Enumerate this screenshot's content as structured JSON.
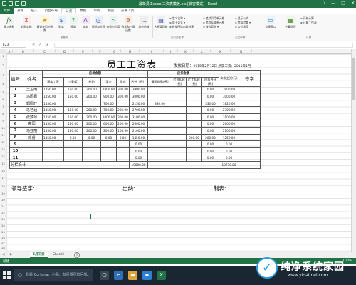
{
  "window": {
    "title": "最新员工excel工资表模板.xls [兼容模式] - Excel",
    "controls": [
      "?",
      "—",
      "□",
      "✕"
    ]
  },
  "ribbon": {
    "tabs": [
      "文件",
      "开始",
      "插入",
      "页面布局",
      "公式",
      "数据",
      "审阅",
      "视图",
      "开发工具"
    ],
    "buttons": [
      {
        "label": "插入函数",
        "icon": "fx"
      },
      {
        "label": "自动求和",
        "icon": "Σ"
      },
      {
        "label": "最近使用的函数",
        "icon": "★"
      },
      {
        "label": "财务",
        "icon": "$"
      },
      {
        "label": "逻辑",
        "icon": "?"
      },
      {
        "label": "文本",
        "icon": "A"
      },
      {
        "label": "日期和时间",
        "icon": "◷"
      },
      {
        "label": "查找与引用",
        "icon": "⌕"
      },
      {
        "label": "数学和三角函数",
        "icon": "θ"
      },
      {
        "label": "其他函数",
        "icon": "…"
      },
      {
        "label": "名称管理器",
        "icon": "▤"
      }
    ],
    "defined_names": [
      "定义名称 ▾",
      "用于公式 ▾",
      "根据所选内容创建"
    ],
    "auditing": [
      "追踪引用单元格",
      "追踪从属单元格",
      "移去箭头 ▾",
      "显示公式",
      "错误检查 ▾",
      "公式求值"
    ],
    "watch_label": "监视窗口",
    "calc_options_label": "计算选项",
    "calc_small": [
      "开始计算",
      "计算工作表"
    ],
    "groups": [
      "函数库",
      "定义的名称",
      "公式审核",
      "计算"
    ]
  },
  "formula_bar": {
    "name_box": "E23",
    "icons": [
      "✕",
      "✓",
      "fx"
    ],
    "value": ""
  },
  "columns": [
    "A",
    "B",
    "C",
    "D",
    "E",
    "F",
    "G",
    "H",
    "I",
    "J",
    "K",
    "L",
    "M",
    "N"
  ],
  "row_numbers": [
    "1",
    "2",
    "3",
    "4",
    "5",
    "6",
    "7",
    "8",
    "9",
    "10",
    "11",
    "12",
    "13",
    "14",
    "15",
    "16",
    "17",
    "18",
    "19",
    "20",
    "21",
    "22",
    "23",
    "24",
    "25",
    "26",
    "27",
    "28",
    "29",
    "30"
  ],
  "sheet": {
    "title": "员工工资表",
    "date_label": "发放日期：",
    "date_value": "2015年2月12日",
    "period": "所属工资：2015年1月",
    "headers": {
      "index": "编号",
      "name": "姓名",
      "earnings_group": "应发金额",
      "base": "基本工资",
      "allowance": "全勤奖",
      "subsidy": "补助",
      "bonus": "奖金",
      "extra": "提成",
      "subtotal": "合计（元）",
      "deduction_group": "应扣金额",
      "leave": "请假扣款(元)",
      "late": "迟到扣款(元)",
      "absence": "旷工扣款(元)",
      "deduct_total": "应扣合计(元)",
      "net": "实发工资(元)",
      "sign": "签字"
    },
    "rows": [
      {
        "no": "1",
        "name": "王卫雨",
        "base": "1450.00",
        "allow": "150.00",
        "sub": "200.00",
        "bonus": "1800.00",
        "extra": "300.00",
        "total": "3900.00",
        "leave": "",
        "late": "",
        "abs": "",
        "dtotal": "0.00",
        "net": "3900.00"
      },
      {
        "no": "2",
        "name": "马国嘉",
        "base": "1450.00",
        "allow": "150.00",
        "sub": "200.00",
        "bonus": "900.00",
        "extra": "300.00",
        "total": "3000.00",
        "leave": "",
        "late": "",
        "abs": "",
        "dtotal": "0.00",
        "net": "3000.00"
      },
      {
        "no": "3",
        "name": "郭国旺",
        "base": "1450.00",
        "allow": "",
        "sub": "",
        "bonus": "700.00",
        "extra": "",
        "total": "2150.00",
        "leave": "330.00",
        "late": "",
        "abs": "",
        "dtotal": "330.00",
        "net": "1820.00"
      },
      {
        "no": "4",
        "name": "马艺涵",
        "base": "1450.00",
        "allow": "150.00",
        "sub": "200.00",
        "bonus": "700.00",
        "extra": "200.00",
        "total": "2700.00",
        "leave": "",
        "late": "",
        "abs": "",
        "dtotal": "0.00",
        "net": "2700.00"
      },
      {
        "no": "5",
        "name": "张梦琴",
        "base": "1450.00",
        "allow": "150.00",
        "sub": "200.00",
        "bonus": "1000.00",
        "extra": "300.00",
        "total": "3100.00",
        "leave": "",
        "late": "",
        "abs": "",
        "dtotal": "0.00",
        "net": "3100.00"
      },
      {
        "no": "6",
        "name": "高阳",
        "base": "1450.00",
        "allow": "150.00",
        "sub": "200.00",
        "bonus": "600.00",
        "extra": "200.00",
        "total": "2600.00",
        "leave": "",
        "late": "",
        "abs": "",
        "dtotal": "0.00",
        "net": "2600.00"
      },
      {
        "no": "7",
        "name": "马亚丽",
        "base": "1450.00",
        "allow": "150.00",
        "sub": "200.00",
        "bonus": "200.00",
        "extra": "100.00",
        "total": "2100.00",
        "leave": "",
        "late": "",
        "abs": "",
        "dtotal": "0.00",
        "net": "2100.00"
      },
      {
        "no": "8",
        "name": "邓睿",
        "base": "1450.00",
        "allow": "0.00",
        "sub": "0.00",
        "bonus": "0.00",
        "extra": "0.00",
        "total": "1450.00",
        "leave": "",
        "late": "",
        "abs": "200.00",
        "dtotal": "200.00",
        "net": "1250.00"
      },
      {
        "no": "9",
        "name": "",
        "base": "",
        "allow": "",
        "sub": "",
        "bonus": "",
        "extra": "",
        "total": "0.00",
        "leave": "",
        "late": "",
        "abs": "",
        "dtotal": "0.00",
        "net": "0.00"
      },
      {
        "no": "10",
        "name": "",
        "base": "",
        "allow": "",
        "sub": "",
        "bonus": "",
        "extra": "",
        "total": "0.00",
        "leave": "",
        "late": "",
        "abs": "",
        "dtotal": "0.00",
        "net": "0.00"
      },
      {
        "no": "11",
        "name": "",
        "base": "",
        "allow": "",
        "sub": "",
        "bonus": "",
        "extra": "",
        "total": "0.00",
        "leave": "",
        "late": "",
        "abs": "",
        "dtotal": "0.00",
        "net": "0.00"
      }
    ],
    "total_row": {
      "label": "分栏合计",
      "total": "19000.00",
      "net": "18770.00"
    },
    "signatures": {
      "leader": "领导签字:",
      "cashier": "出纳:",
      "preparer": "制表:"
    }
  },
  "sheet_tabs": {
    "nav": "◀ ▶",
    "tabs": [
      "5月工资",
      "Sheet3"
    ],
    "add": "+"
  },
  "status": {
    "ready": "就绪",
    "zoom": "100%"
  },
  "taskbar": {
    "search_placeholder": "我是 Cortana，小娜。有问题尽管问我。"
  },
  "watermark": {
    "brand": "纯净系统家园",
    "url": "www.yidaimei.com"
  }
}
